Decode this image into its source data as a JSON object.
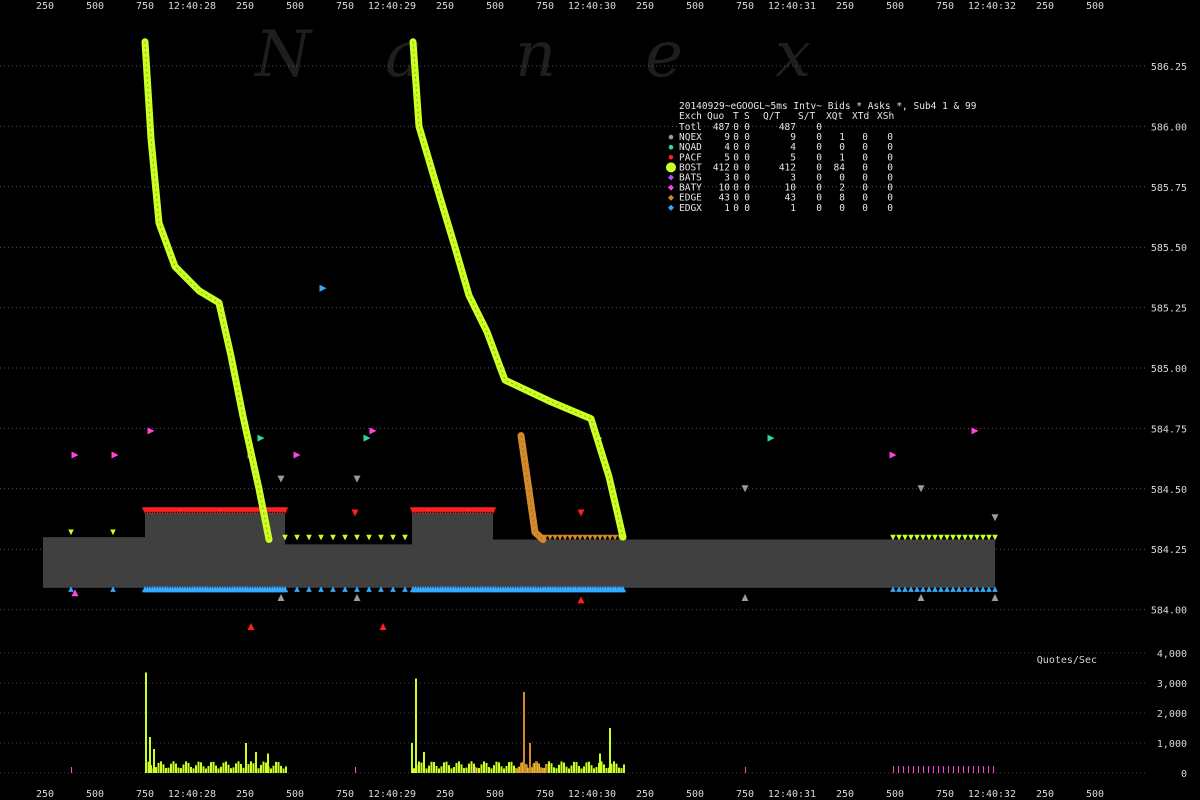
{
  "chart_data": {
    "type": "scatter",
    "title": "20140929~eGOOGL~5ms Intv~ Bids * Asks *, Sub4 1 & 99",
    "watermark": [
      "N",
      "a",
      "n",
      "e",
      "x"
    ],
    "x_axis": {
      "tick_labels": [
        "250",
        "500",
        "750",
        "12:40:28",
        "250",
        "500",
        "750",
        "12:40:29",
        "250",
        "500",
        "750",
        "12:40:30",
        "250",
        "500",
        "750",
        "12:40:31",
        "250",
        "500",
        "750",
        "12:40:32",
        "250",
        "500"
      ],
      "range": [
        "12:40:27.750",
        "12:40:32.500"
      ]
    },
    "y_axis": {
      "ticks": [
        "586.25",
        "586.00",
        "585.75",
        "585.50",
        "585.25",
        "585.00",
        "584.75",
        "584.50",
        "584.25",
        "584.00"
      ],
      "range": [
        583.98,
        586.48
      ]
    },
    "rate_axis": {
      "label": "Quotes/Sec",
      "ticks": [
        "4,000",
        "3,000",
        "2,000",
        "1,000",
        "0"
      ],
      "range": [
        0,
        4000
      ]
    },
    "legend": {
      "header": [
        "Exch",
        "Quo",
        "T",
        "S",
        "Q/T",
        "S/T",
        "XQt",
        "XTd",
        "XSh"
      ],
      "rows": [
        {
          "exch": "Totl",
          "quo": "487",
          "t": "0",
          "s": "0",
          "qt": "487",
          "st": "0",
          "xqt": "",
          "xtd": "",
          "xsh": "",
          "color": ""
        },
        {
          "exch": "NQEX",
          "quo": "9",
          "t": "0",
          "s": "0",
          "qt": "9",
          "st": "0",
          "xqt": "1",
          "xtd": "0",
          "xsh": "0",
          "color": "#9a9a9a"
        },
        {
          "exch": "NQAD",
          "quo": "4",
          "t": "0",
          "s": "0",
          "qt": "4",
          "st": "0",
          "xqt": "0",
          "xtd": "0",
          "xsh": "0",
          "color": "#2fd8a0"
        },
        {
          "exch": "PACF",
          "quo": "5",
          "t": "0",
          "s": "0",
          "qt": "5",
          "st": "0",
          "xqt": "1",
          "xtd": "0",
          "xsh": "0",
          "color": "#ff2020"
        },
        {
          "exch": "BOST",
          "quo": "412",
          "t": "0",
          "s": "0",
          "qt": "412",
          "st": "0",
          "xqt": "84",
          "xtd": "0",
          "xsh": "0",
          "color": "#ccff22"
        },
        {
          "exch": "BATS",
          "quo": "3",
          "t": "0",
          "s": "0",
          "qt": "3",
          "st": "0",
          "xqt": "0",
          "xtd": "0",
          "xsh": "0",
          "color": "#b84cff"
        },
        {
          "exch": "BATY",
          "quo": "10",
          "t": "0",
          "s": "0",
          "qt": "10",
          "st": "0",
          "xqt": "2",
          "xtd": "0",
          "xsh": "0",
          "color": "#ff44dd"
        },
        {
          "exch": "EDGE",
          "quo": "43",
          "t": "0",
          "s": "0",
          "qt": "43",
          "st": "0",
          "xqt": "8",
          "xtd": "0",
          "xsh": "0",
          "color": "#d48a2a"
        },
        {
          "exch": "EDGX",
          "quo": "1",
          "t": "0",
          "s": "0",
          "qt": "1",
          "st": "0",
          "xqt": "0",
          "xtd": "0",
          "xsh": "0",
          "color": "#33aaff"
        }
      ]
    },
    "nbbo_spread": [
      {
        "t0": 27.74,
        "t1": 28.25,
        "bid": 584.09,
        "ask": 584.3
      },
      {
        "t0": 28.25,
        "t1": 28.95,
        "bid": 584.09,
        "ask": 584.4
      },
      {
        "t0": 28.95,
        "t1": 29.585,
        "bid": 584.09,
        "ask": 584.27
      },
      {
        "t0": 29.585,
        "t1": 29.99,
        "bid": 584.09,
        "ask": 584.4
      },
      {
        "t0": 29.99,
        "t1": 32.5,
        "bid": 584.09,
        "ask": 584.29
      }
    ],
    "series": [
      {
        "name": "BOST",
        "color": "#ccff22",
        "kind": "ask-sweep",
        "points": [
          [
            28.25,
            586.35
          ],
          [
            28.28,
            585.95
          ],
          [
            28.32,
            585.6
          ],
          [
            28.4,
            585.42
          ],
          [
            28.52,
            585.32
          ],
          [
            28.62,
            585.27
          ],
          [
            28.68,
            585.05
          ],
          [
            28.74,
            584.8
          ],
          [
            28.82,
            584.5
          ],
          [
            28.87,
            584.29
          ]
        ]
      },
      {
        "name": "BOST",
        "color": "#ccff22",
        "kind": "ask-sweep",
        "points": [
          [
            29.59,
            586.35
          ],
          [
            29.62,
            586.0
          ],
          [
            29.72,
            585.72
          ],
          [
            29.8,
            585.5
          ],
          [
            29.87,
            585.3
          ],
          [
            29.96,
            585.15
          ],
          [
            30.05,
            584.95
          ],
          [
            30.28,
            584.86
          ],
          [
            30.48,
            584.79
          ],
          [
            30.57,
            584.55
          ],
          [
            30.64,
            584.3
          ]
        ]
      },
      {
        "name": "EDGE",
        "color": "#d48a2a",
        "kind": "ask-drop",
        "points": [
          [
            30.13,
            584.72
          ],
          [
            30.16,
            584.55
          ],
          [
            30.2,
            584.32
          ],
          [
            30.24,
            584.29
          ]
        ]
      }
    ],
    "spread_markers": [
      {
        "name": "PACF",
        "color": "#ff2020",
        "side": "ask",
        "from": 28.25,
        "to": 28.95,
        "price": 584.41
      },
      {
        "name": "PACF",
        "color": "#ff2020",
        "side": "ask",
        "from": 29.59,
        "to": 29.99,
        "price": 584.41
      },
      {
        "name": "EDGX",
        "color": "#33aaff",
        "side": "bid",
        "from": 28.25,
        "to": 28.95,
        "price": 584.085
      },
      {
        "name": "EDGX",
        "color": "#33aaff",
        "side": "bid",
        "from": 29.59,
        "to": 30.64,
        "price": 584.085
      }
    ],
    "scattered_quotes": [
      {
        "name": "BATY",
        "color": "#ff44dd",
        "t": 27.9,
        "price": 584.64
      },
      {
        "name": "BATY",
        "color": "#ff44dd",
        "t": 28.1,
        "price": 584.64
      },
      {
        "name": "BATY",
        "color": "#ff44dd",
        "t": 28.28,
        "price": 584.74
      },
      {
        "name": "BATY",
        "color": "#ff44dd",
        "t": 28.78,
        "price": 584.64
      },
      {
        "name": "BATY",
        "color": "#ff44dd",
        "t": 29.01,
        "price": 584.64
      },
      {
        "name": "BATY",
        "color": "#ff44dd",
        "t": 29.39,
        "price": 584.74
      },
      {
        "name": "BATY",
        "color": "#ff44dd",
        "t": 31.99,
        "price": 584.64
      },
      {
        "name": "BATY",
        "color": "#ff44dd",
        "t": 32.4,
        "price": 584.74
      },
      {
        "name": "BATY",
        "color": "#ff44dd",
        "t": 27.9,
        "price": 584.07
      },
      {
        "name": "NQAD",
        "color": "#2fd8a0",
        "t": 28.83,
        "price": 584.71
      },
      {
        "name": "NQAD",
        "color": "#2fd8a0",
        "t": 29.36,
        "price": 584.71
      },
      {
        "name": "NQAD",
        "color": "#2fd8a0",
        "t": 30.52,
        "price": 584.71
      },
      {
        "name": "NQAD",
        "color": "#2fd8a0",
        "t": 31.38,
        "price": 584.71
      },
      {
        "name": "EDGX",
        "color": "#33aaff",
        "t": 29.14,
        "price": 585.33
      },
      {
        "name": "NQEX",
        "color": "#9a9a9a",
        "t": 28.93,
        "price": 584.54
      },
      {
        "name": "NQEX",
        "color": "#9a9a9a",
        "t": 29.31,
        "price": 584.54
      },
      {
        "name": "NQEX",
        "color": "#9a9a9a",
        "t": 31.25,
        "price": 584.5
      },
      {
        "name": "NQEX",
        "color": "#9a9a9a",
        "t": 32.13,
        "price": 584.5
      },
      {
        "name": "NQEX",
        "color": "#9a9a9a",
        "t": 32.5,
        "price": 584.38
      },
      {
        "name": "NQEX",
        "color": "#9a9a9a",
        "t": 28.93,
        "price": 584.05
      },
      {
        "name": "NQEX",
        "color": "#9a9a9a",
        "t": 29.31,
        "price": 584.05
      },
      {
        "name": "NQEX",
        "color": "#9a9a9a",
        "t": 31.25,
        "price": 584.05
      },
      {
        "name": "NQEX",
        "color": "#9a9a9a",
        "t": 32.13,
        "price": 584.05
      },
      {
        "name": "NQEX",
        "color": "#9a9a9a",
        "t": 32.5,
        "price": 584.05
      },
      {
        "name": "PACF",
        "color": "#ff2020",
        "t": 28.78,
        "price": 583.93
      },
      {
        "name": "PACF",
        "color": "#ff2020",
        "t": 29.44,
        "price": 583.93
      },
      {
        "name": "PACF",
        "color": "#ff2020",
        "t": 29.3,
        "price": 584.4
      },
      {
        "name": "PACF",
        "color": "#ff2020",
        "t": 30.43,
        "price": 584.4
      },
      {
        "name": "PACF",
        "color": "#ff2020",
        "t": 30.43,
        "price": 584.04
      }
    ],
    "quote_rate": [
      {
        "t": 28.25,
        "v": 3350,
        "color": "#ccff22"
      },
      {
        "t": 28.27,
        "v": 1200,
        "color": "#ccff22"
      },
      {
        "t": 28.29,
        "v": 800,
        "color": "#ccff22"
      },
      {
        "t": 28.75,
        "v": 1000,
        "color": "#ccff22"
      },
      {
        "t": 28.8,
        "v": 700,
        "color": "#ccff22"
      },
      {
        "t": 28.86,
        "v": 650,
        "color": "#ccff22"
      },
      {
        "t": 29.6,
        "v": 3150,
        "color": "#ccff22"
      },
      {
        "t": 29.58,
        "v": 1000,
        "color": "#ccff22"
      },
      {
        "t": 29.64,
        "v": 700,
        "color": "#ccff22"
      },
      {
        "t": 30.14,
        "v": 2700,
        "color": "#d48a2a"
      },
      {
        "t": 30.17,
        "v": 1000,
        "color": "#d48a2a"
      },
      {
        "t": 30.57,
        "v": 1500,
        "color": "#ccff22"
      },
      {
        "t": 30.52,
        "v": 650,
        "color": "#ccff22"
      }
    ]
  }
}
